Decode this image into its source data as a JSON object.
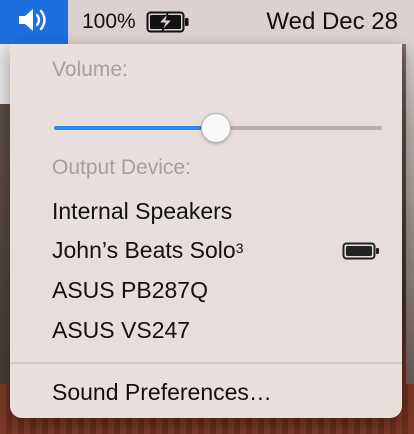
{
  "menubar": {
    "battery_percent": "100%",
    "date": "Wed Dec 28",
    "volume_icon": "speaker-icon",
    "battery_icon": "battery-charging-icon"
  },
  "menu": {
    "volume_label": "Volume:",
    "volume_level": 0.495,
    "output_label": "Output Device:",
    "devices": [
      {
        "label": "Internal Speakers"
      },
      {
        "label": "John’s Beats Solo",
        "suffix": "3",
        "battery_icon": "battery-full-icon"
      },
      {
        "label": "ASUS PB287Q"
      },
      {
        "label": "ASUS VS247"
      }
    ],
    "preferences_label": "Sound Preferences…"
  },
  "colors": {
    "accent": "#1d6fe0",
    "slider_fill": "#2a8af0",
    "label_gray": "#a59f9d"
  }
}
